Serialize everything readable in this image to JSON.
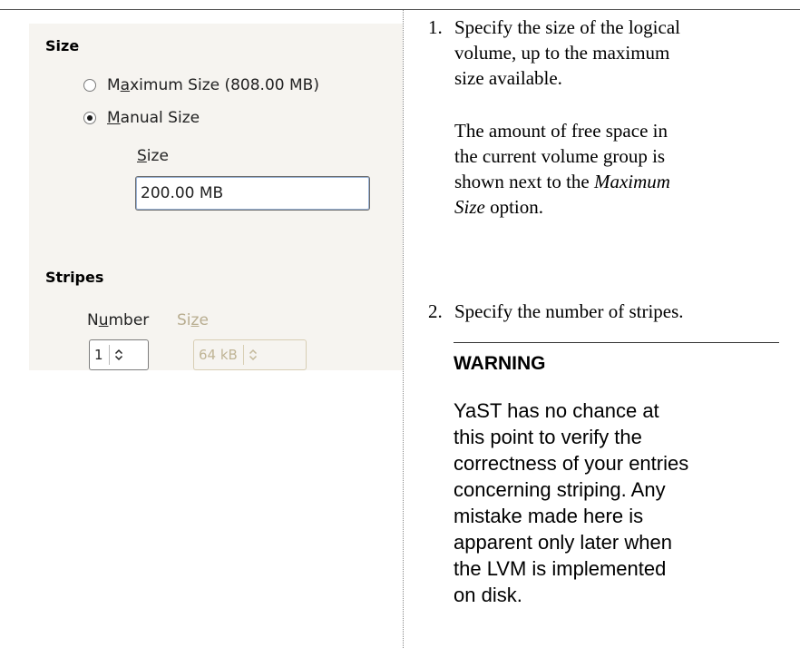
{
  "gui": {
    "size_section": {
      "title": "Size",
      "options": [
        {
          "label_pre": "M",
          "label_u": "a",
          "label_post": "ximum Size (808.00 MB)",
          "checked": false
        },
        {
          "label_pre": "",
          "label_u": "M",
          "label_post": "anual Size",
          "checked": true
        }
      ],
      "size_field": {
        "label_u": "S",
        "label_post": "ize",
        "value": "200.00 MB"
      }
    },
    "stripes_section": {
      "title": "Stripes",
      "number": {
        "label_pre": "N",
        "label_u": "u",
        "label_post": "mber",
        "value": "1"
      },
      "size": {
        "label_pre": "Si",
        "label_u": "z",
        "label_post": "e",
        "value": "64 kB",
        "disabled": true
      }
    }
  },
  "doc": {
    "step1": {
      "num": "1.",
      "lines": [
        "Specify the size of the logical",
        "volume, up to the maximum",
        "size available."
      ],
      "para2_lines": [
        "The amount of free space in",
        "the current volume group is"
      ],
      "para2_line3_pre": "shown next to the ",
      "para2_line3_em": "Maximum",
      "para2_line4_em": "Size",
      "para2_line4_post": " option."
    },
    "step2": {
      "num": "2.",
      "text": "Specify the number of stripes."
    },
    "warning": {
      "title": "WARNING",
      "lines": [
        "YaST has no chance at",
        "this point to verify the",
        "correctness of your entries",
        "concerning striping. Any",
        "mistake made here is",
        "apparent only later when",
        "the LVM is implemented",
        "on disk."
      ]
    }
  }
}
